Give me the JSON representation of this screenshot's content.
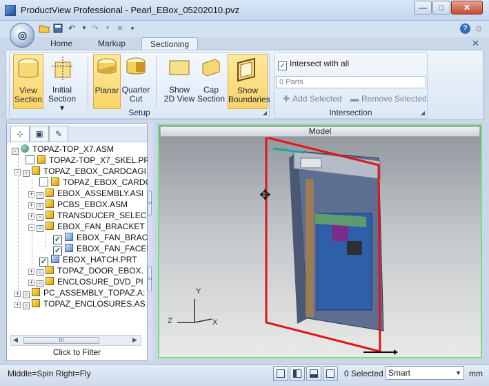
{
  "window": {
    "title": "ProductView Professional - Pearl_EBox_05202010.pvz",
    "minimize_glyph": "—",
    "maximize_glyph": "□",
    "close_glyph": "✕"
  },
  "quick_access": {
    "icons": [
      "open-folder-icon",
      "save-icon",
      "undo-icon",
      "dropdown-icon",
      "redo-icon",
      "dropdown-icon",
      "delete-icon",
      "customize-icon"
    ],
    "help_glyph": "?"
  },
  "tabs": [
    {
      "label": "Home",
      "active": false
    },
    {
      "label": "Markup",
      "active": false
    },
    {
      "label": "Sectioning",
      "active": true
    }
  ],
  "ribbon": {
    "view_section": {
      "line1": "View",
      "line2": "Section"
    },
    "initial_section": {
      "line1": "Initial",
      "line2": "Section ▾"
    },
    "planar": {
      "line1": "Planar",
      "line2": ""
    },
    "quarter_cut": {
      "line1": "Quarter",
      "line2": "Cut"
    },
    "show_2d_view": {
      "line1": "Show",
      "line2": "2D View"
    },
    "cap_section": {
      "line1": "Cap",
      "line2": "Section"
    },
    "show_boundaries": {
      "line1": "Show",
      "line2": "Boundaries"
    },
    "setup_label": "Setup",
    "intersect_label": "Intersect with all",
    "parts_value": "0 Parts",
    "add_selected": "Add Selected",
    "remove_selected": "Remove Selected",
    "intersection_label": "Intersection"
  },
  "tree": {
    "items": [
      {
        "label": "TOPAZ-TOP_X7.ASM"
      },
      {
        "label": "TOPAZ-TOP_X7_SKEL.PR"
      },
      {
        "label": "TOPAZ_EBOX_CARDCAGI"
      },
      {
        "label": "TOPAZ_EBOX_CARDC"
      },
      {
        "label": "EBOX_ASSEMBLY.ASI"
      },
      {
        "label": "PCBS_EBOX.ASM"
      },
      {
        "label": "TRANSDUCER_SELEC"
      },
      {
        "label": "EBOX_FAN_BRACKET"
      },
      {
        "label": "EBOX_FAN_BRAC"
      },
      {
        "label": "EBOX_FAN_FACEI"
      },
      {
        "label": "EBOX_HATCH.PRT"
      },
      {
        "label": "TOPAZ_DOOR_EBOX."
      },
      {
        "label": "ENCLOSURE_DVD_PI"
      },
      {
        "label": "PC_ASSEMBLY_TOPAZ.A:"
      },
      {
        "label": "TOPAZ_ENCLOSURES.AS"
      }
    ],
    "scroll_thumb_label": "III",
    "filter_label": "Click to Filter"
  },
  "viewport": {
    "header": "Model",
    "axis_x": "X",
    "axis_y": "Y",
    "axis_z": "Z"
  },
  "status": {
    "hint": "Middle=Spin  Right=Fly",
    "selected": "0 Selected",
    "mode": "Smart",
    "units": "mm"
  },
  "colors": {
    "selected_button": "#fbd467",
    "viewport_border": "#71e07a",
    "section_plane": "#e0141a"
  }
}
